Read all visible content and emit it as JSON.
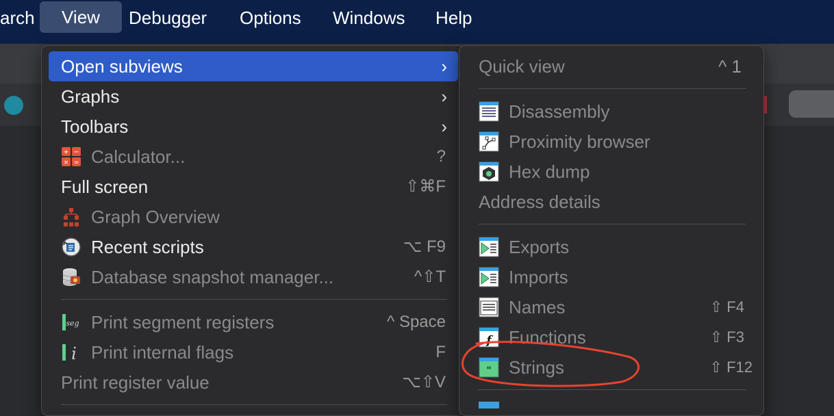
{
  "menubar": {
    "items": [
      {
        "label": "arch"
      },
      {
        "label": "View"
      },
      {
        "label": "Debugger"
      },
      {
        "label": "Options"
      },
      {
        "label": "Windows"
      },
      {
        "label": "Help"
      }
    ]
  },
  "view_menu": {
    "items": [
      {
        "label": "Open subviews",
        "shortcut": ">"
      },
      {
        "label": "Graphs",
        "shortcut": ">"
      },
      {
        "label": "Toolbars",
        "shortcut": ">"
      },
      {
        "label": "Calculator...",
        "shortcut": "?"
      },
      {
        "label": "Full screen",
        "shortcut": "⇧⌘F"
      },
      {
        "label": "Graph Overview",
        "shortcut": ""
      },
      {
        "label": "Recent scripts",
        "shortcut": "⌥ F9"
      },
      {
        "label": "Database snapshot manager...",
        "shortcut": "^⇧T"
      },
      {
        "label": "Print segment registers",
        "shortcut": "^ Space"
      },
      {
        "label": "Print internal flags",
        "shortcut": "F"
      },
      {
        "label": "Print register value",
        "shortcut": "⌥⇧V"
      }
    ]
  },
  "subviews_menu": {
    "items": [
      {
        "label": "Quick view",
        "shortcut": "^ 1"
      },
      {
        "label": "Disassembly",
        "shortcut": ""
      },
      {
        "label": "Proximity browser",
        "shortcut": ""
      },
      {
        "label": "Hex dump",
        "shortcut": ""
      },
      {
        "label": "Address details",
        "shortcut": ""
      },
      {
        "label": "Exports",
        "shortcut": ""
      },
      {
        "label": "Imports",
        "shortcut": ""
      },
      {
        "label": "Names",
        "shortcut": "⇧ F4"
      },
      {
        "label": "Functions",
        "shortcut": "⇧ F3"
      },
      {
        "label": "Strings",
        "shortcut": "⇧ F12"
      }
    ]
  },
  "colors": {
    "menubar_bg": "#0c2047",
    "highlight": "#2e5cc8",
    "annotation": "#e8432e"
  }
}
